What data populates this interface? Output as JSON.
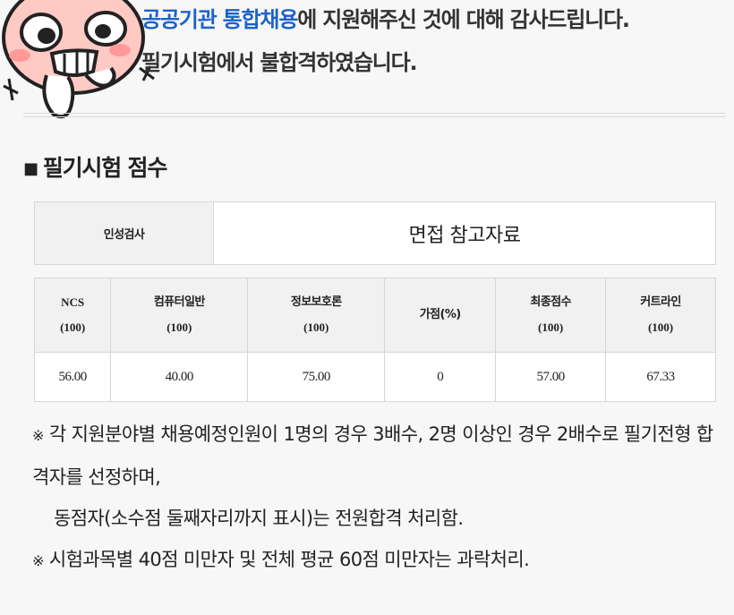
{
  "message": {
    "highlight": "공공기관 통합채용",
    "line1_rest": "에 지원해주신 것에 대해 감사드립니다.",
    "line2": "필기시험에서 불합격하였습니다."
  },
  "section": {
    "bullet": "■",
    "title": "필기시험 점수"
  },
  "personality": {
    "header": "인성검사",
    "value": "면접 참고자료"
  },
  "scores": {
    "headers": [
      {
        "name": "NCS",
        "max": "(100)"
      },
      {
        "name": "컴퓨터일반",
        "max": "(100)"
      },
      {
        "name": "정보보호론",
        "max": "(100)"
      },
      {
        "name": "가점(%)",
        "max": ""
      },
      {
        "name": "최종점수",
        "max": "(100)"
      },
      {
        "name": "커트라인",
        "max": "(100)"
      }
    ],
    "values": [
      "56.00",
      "40.00",
      "75.00",
      "0",
      "57.00",
      "67.33"
    ]
  },
  "notes": {
    "mark": "※",
    "line1": "각 지원분야별 채용예정인원이 1명의 경우 3배수, 2명 이상인 경우 2배수로 필기전형 합격자를 선정하며,",
    "line2": "동점자(소수점 둘째자리까지 표시)는 전원합격 처리함.",
    "line3": "시험과목별 40점 미만자 및 전체 평균 60점 미만자는 과락처리."
  },
  "colors": {
    "accent": "#1d63c9",
    "mascot_face": "#ffc9c4"
  }
}
